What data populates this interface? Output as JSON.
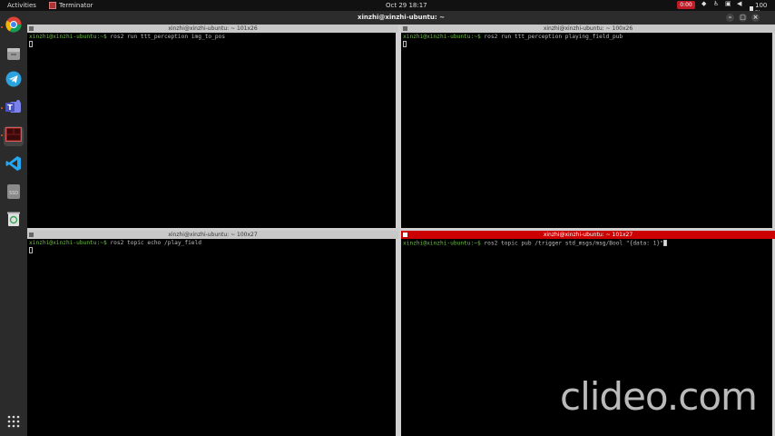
{
  "topbar": {
    "activities": "Activities",
    "app_name": "Terminator",
    "clock": "Oct 29  18:17",
    "recording": "0:00",
    "battery": "100 %"
  },
  "dock": {
    "items": [
      "chrome-icon",
      "files-icon",
      "telegram-icon",
      "teams-icon",
      "terminator-icon",
      "vscode-icon",
      "disk-icon",
      "trash-icon"
    ],
    "apps_grid": "show-applications-icon"
  },
  "window": {
    "title": "xinzhi@xinzhi-ubuntu: ~"
  },
  "panes": [
    {
      "title": "xinzhi@xinzhi-ubuntu: ~ 101x26",
      "prompt": "xinzhi@xinzhi-ubuntu:~$ ",
      "command": "ros2 run ttt_perception img_to_pos"
    },
    {
      "title": "xinzhi@xinzhi-ubuntu: ~ 100x26",
      "prompt": "xinzhi@xinzhi-ubuntu:~$ ",
      "command": "ros2 run ttt_perception playing_field_pub"
    },
    {
      "title": "xinzhi@xinzhi-ubuntu: ~ 100x27",
      "prompt": "xinzhi@xinzhi-ubuntu:~$ ",
      "command": "ros2 topic echo /play_field"
    },
    {
      "title": "xinzhi@xinzhi-ubuntu: ~ 101x27",
      "prompt": "xinzhi@xinzhi-ubuntu:~$ ",
      "command": "ros2 topic pub /trigger std_msgs/msg/Bool \"{data: 1}\""
    }
  ],
  "watermark": "clideo.com",
  "colors": {
    "active_title": "#cc0000",
    "prompt": "#6fbf45",
    "dock_bg": "#2b2b2b"
  }
}
